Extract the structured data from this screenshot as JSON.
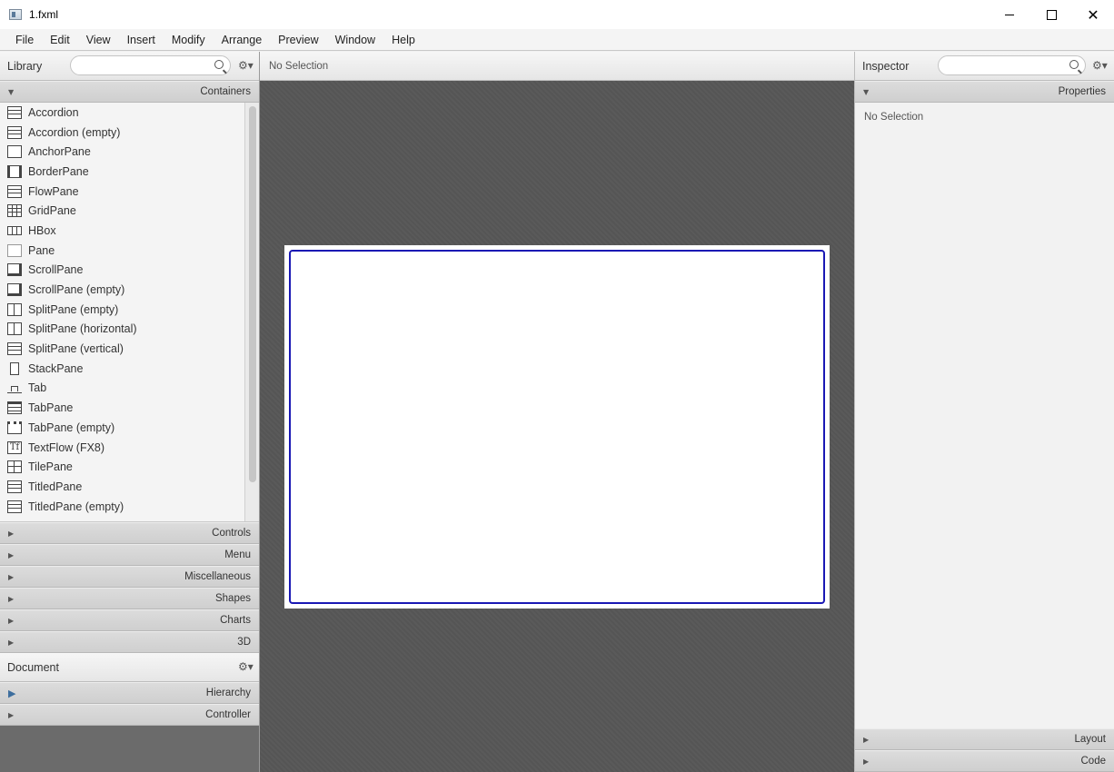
{
  "window": {
    "title": "1.fxml",
    "min_glyph": "",
    "max_glyph": "",
    "close_glyph": "✕"
  },
  "menu": [
    "File",
    "Edit",
    "View",
    "Insert",
    "Modify",
    "Arrange",
    "Preview",
    "Window",
    "Help"
  ],
  "library": {
    "title": "Library",
    "search_placeholder": "",
    "gear_glyph": "⚙▾",
    "containers_section": "Containers",
    "items": [
      {
        "label": "Accordion",
        "icon": "accordion-icon"
      },
      {
        "label": "Accordion  (empty)",
        "icon": "accordion-icon"
      },
      {
        "label": "AnchorPane",
        "icon": "anchor-icon"
      },
      {
        "label": "BorderPane",
        "icon": "borderpane-icon"
      },
      {
        "label": "FlowPane",
        "icon": "flowpane-icon"
      },
      {
        "label": "GridPane",
        "icon": "gridpane-icon"
      },
      {
        "label": "HBox",
        "icon": "hbox-icon"
      },
      {
        "label": "Pane",
        "icon": "pane-icon"
      },
      {
        "label": "ScrollPane",
        "icon": "scrollpane-icon"
      },
      {
        "label": "ScrollPane  (empty)",
        "icon": "scrollpane-icon"
      },
      {
        "label": "SplitPane  (empty)",
        "icon": "splitpane-icon"
      },
      {
        "label": "SplitPane  (horizontal)",
        "icon": "splitpane-icon"
      },
      {
        "label": "SplitPane  (vertical)",
        "icon": "splitpane-icon"
      },
      {
        "label": "StackPane",
        "icon": "stackpane-icon"
      },
      {
        "label": "Tab",
        "icon": "tab-icon"
      },
      {
        "label": "TabPane",
        "icon": "tabpane-icon"
      },
      {
        "label": "TabPane  (empty)",
        "icon": "tabpane-icon"
      },
      {
        "label": "TextFlow  (FX8)",
        "icon": "textflow-icon"
      },
      {
        "label": "TilePane",
        "icon": "tilepane-icon"
      },
      {
        "label": "TitledPane",
        "icon": "titledpane-icon"
      },
      {
        "label": "TitledPane  (empty)",
        "icon": "titledpane-icon"
      }
    ],
    "sections": [
      "Controls",
      "Menu",
      "Miscellaneous",
      "Shapes",
      "Charts",
      "3D"
    ]
  },
  "document": {
    "title": "Document",
    "gear_glyph": "⚙▾",
    "sections": [
      "Hierarchy",
      "Controller"
    ]
  },
  "content": {
    "header": "No Selection"
  },
  "inspector": {
    "title": "Inspector",
    "search_placeholder": "",
    "gear_glyph": "⚙▾",
    "properties_section": "Properties",
    "body_text": "No Selection",
    "bottom_sections": [
      "Layout",
      "Code"
    ]
  },
  "glyphs": {
    "expanded": "▼",
    "collapsed": "▶",
    "textflow": "Tf"
  }
}
